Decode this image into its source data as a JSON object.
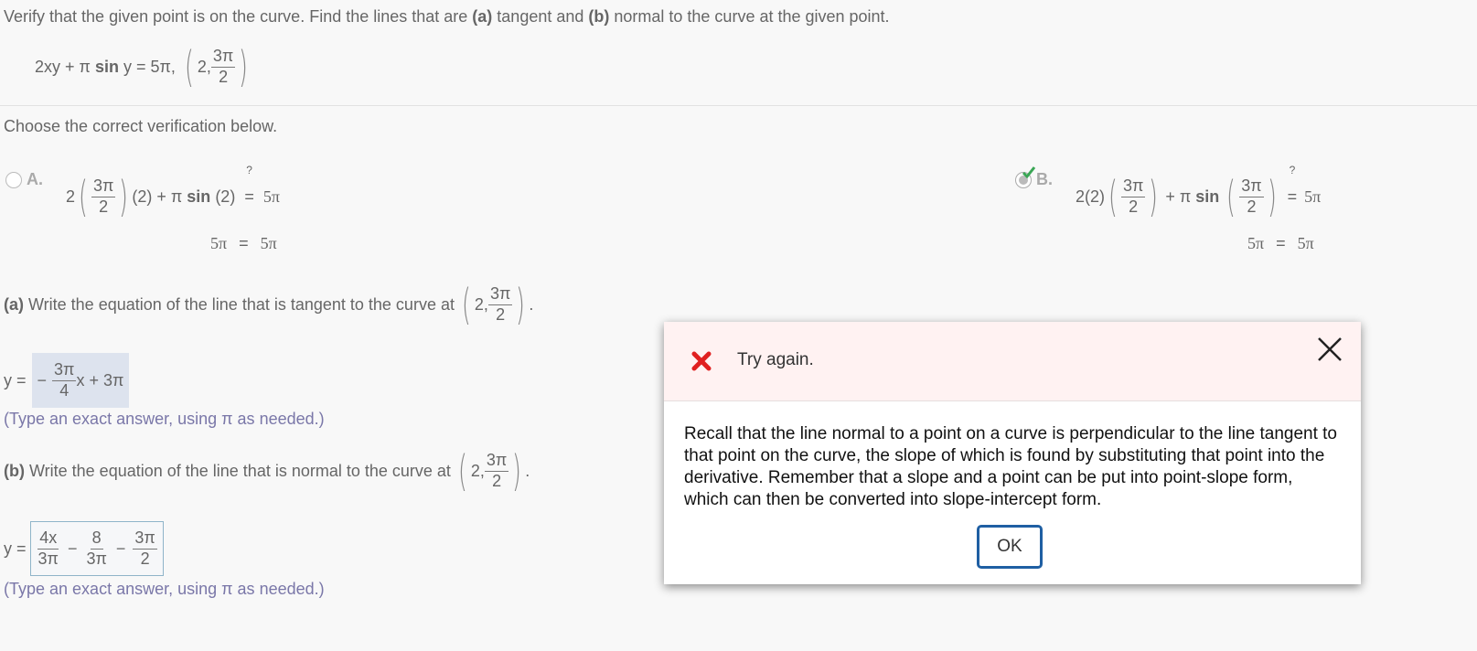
{
  "problem": {
    "instruction_pre": "Verify that the given point is on the curve. Find the lines that are ",
    "a_label": "(a)",
    "instruction_mid": " tangent and ",
    "b_label": "(b)",
    "instruction_post": " normal to the curve at the given point.",
    "equation_lhs_1": "2xy + π ",
    "equation_sin": "sin",
    "equation_lhs_2": " y = 5π,",
    "point_x": "2,",
    "point_num": "3π",
    "point_den": "2"
  },
  "verification": {
    "prompt": "Choose the correct verification below.",
    "option_a": {
      "letter": "A.",
      "coef": "2",
      "frac_num": "3π",
      "frac_den": "2",
      "rest1": "(2) + π ",
      "sin": "sin",
      "rest2": " (2)",
      "qmark": "?",
      "eq": "=",
      "rhs": "5π",
      "line2_lhs": "5π",
      "line2_eq": "=",
      "line2_rhs": "5π"
    },
    "option_b": {
      "letter": "B.",
      "coef": "2(2)",
      "frac1_num": "3π",
      "frac1_den": "2",
      "mid": "+ π ",
      "sin": "sin",
      "frac2_num": "3π",
      "frac2_den": "2",
      "qmark": "?",
      "eq": "=",
      "rhs": "5π",
      "line2_lhs": "5π",
      "line2_eq": "=",
      "line2_rhs": "5π",
      "check_color": "#3aa655"
    }
  },
  "part_a": {
    "label": "(a)",
    "text": " Write the equation of the line that is tangent to the curve at",
    "point_x": "2,",
    "point_num": "3π",
    "point_den": "2",
    "period": ".",
    "answer_prefix": "y =",
    "answer_sign": "−",
    "answer_num": "3π",
    "answer_den": "4",
    "answer_rest": "x + 3π",
    "hint": "(Type an exact answer, using π as needed.)"
  },
  "part_b": {
    "label": "(b)",
    "text": " Write the equation of the line that is normal to the curve at",
    "point_x": "2,",
    "point_num": "3π",
    "point_den": "2",
    "period": ".",
    "answer_prefix": "y =",
    "t1_num": "4x",
    "t1_den": "3π",
    "op1": "−",
    "t2_num": "8",
    "t2_den": "3π",
    "op2": "−",
    "t3_num": "3π",
    "t3_den": "2",
    "hint": "(Type an exact answer, using π as needed.)"
  },
  "dialog": {
    "title": "Try again.",
    "message": "Recall that the line normal to a point on a curve is perpendicular to the line tangent to that point on the curve, the slope of which is found by substituting that point into the derivative. Remember that a slope and a point can be put into point-slope form, which can then be converted into slope-intercept form.",
    "ok_label": "OK",
    "error_color": "#e02020",
    "ok_border_color": "#1f5fa3"
  }
}
